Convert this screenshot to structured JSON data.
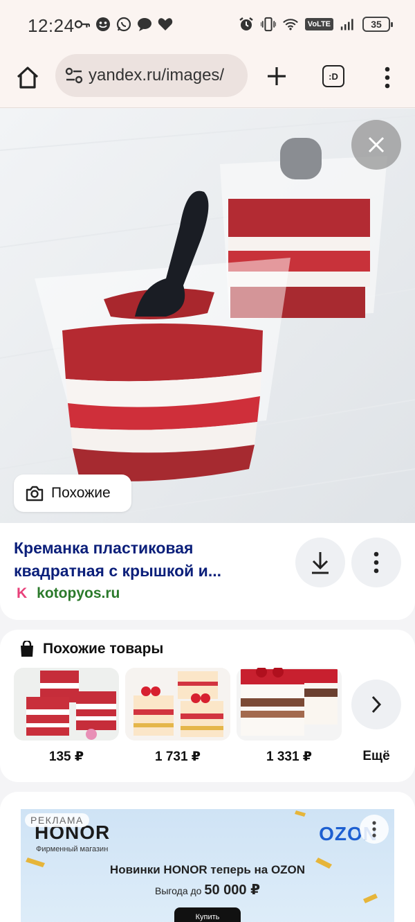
{
  "status_bar": {
    "time": "12:24",
    "left_icons": [
      "key-icon",
      "smiley-icon",
      "whatsapp-icon",
      "chat-icon",
      "heart-icon"
    ],
    "right_icons": [
      "alarm-icon",
      "vibrate-icon",
      "wifi-icon",
      "volte-icon",
      "signal-icon",
      "battery-icon"
    ],
    "volte_label": "VoLTE",
    "battery_level": "35"
  },
  "browser": {
    "url": "yandex.ru/images/",
    "tabs_label": ":D"
  },
  "image_viewer": {
    "similar_button_label": "Похожие"
  },
  "result": {
    "title": "Креманка пластиковая квадратная с крышкой и...",
    "source_logo": "K",
    "source_domain": "kotopyos.ru"
  },
  "similar_products": {
    "heading": "Похожие товары",
    "items": [
      {
        "price": "135 ₽"
      },
      {
        "price": "1 731 ₽"
      },
      {
        "price": "1 331 ₽"
      }
    ],
    "more_label": "Ещё"
  },
  "ad": {
    "tag": "РЕКЛАМА",
    "brand": "HONOR",
    "brand_sub": "Фирменный магазин",
    "shop": "OZON",
    "line1": "Новинки HONOR  теперь на OZON",
    "line2_prefix": "Выгода до",
    "line2_amount": "50 000 ₽",
    "cta": "Купить"
  },
  "colors": {
    "title": "#0b1f7a",
    "source_domain": "#2b7a2b",
    "source_logo": "#e8417a",
    "chrome_bg": "#fbf4f1"
  }
}
